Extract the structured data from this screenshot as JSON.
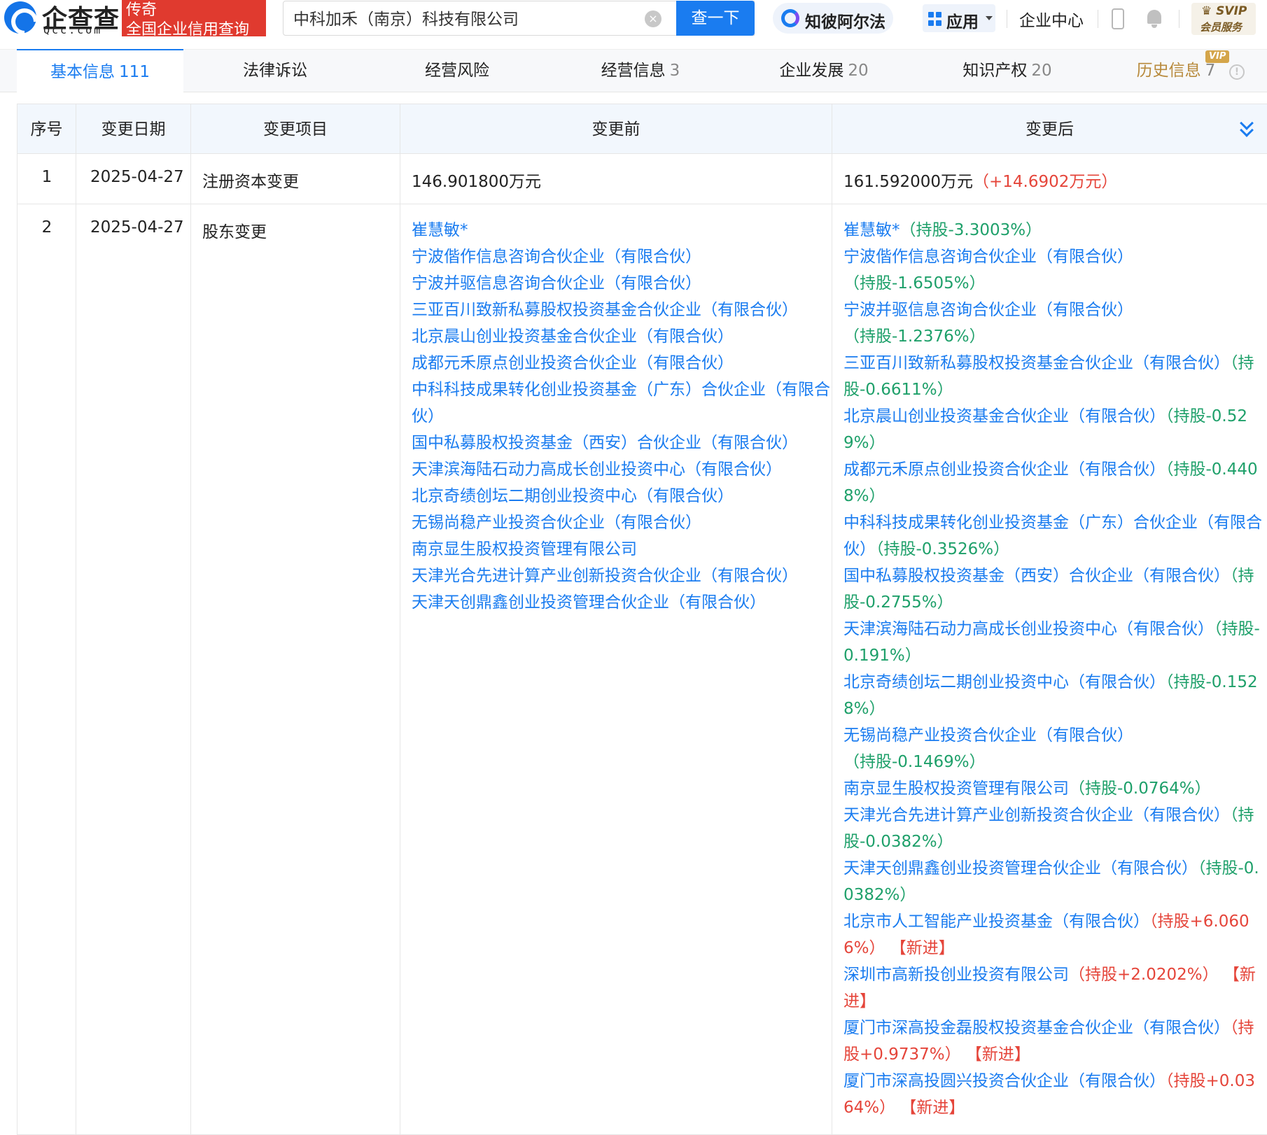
{
  "header": {
    "logo_cn": "企查查",
    "logo_en": "Qcc.com",
    "badge_line1": "传奇",
    "badge_line2": "全国企业信用查询",
    "search_value": "中科加禾（南京）科技有限公司",
    "search_button": "查一下",
    "ai_label": "知彼阿尔法",
    "apps_label": "应用",
    "enterprise_center": "企业中心",
    "svip_top": "SVIP",
    "svip_bottom": "会员服务"
  },
  "tabs": [
    {
      "label": "基本信息",
      "count": "111",
      "active": true
    },
    {
      "label": "法律诉讼",
      "count": ""
    },
    {
      "label": "经营风险",
      "count": ""
    },
    {
      "label": "经营信息",
      "count": "3"
    },
    {
      "label": "企业发展",
      "count": "20"
    },
    {
      "label": "知识产权",
      "count": "20"
    },
    {
      "label": "历史信息",
      "count": "7",
      "vip": "VIP"
    }
  ],
  "table": {
    "headers": [
      "序号",
      "变更日期",
      "变更项目",
      "变更前",
      "变更后"
    ],
    "rows": [
      {
        "seq": "1",
        "date": "2025-04-27",
        "item": "注册资本变更",
        "before": "146.901800万元",
        "after": "161.592000万元",
        "after_delta": "（+14.6902万元）"
      },
      {
        "seq": "2",
        "date": "2025-04-27",
        "item": "股东变更",
        "before_list": [
          "崔慧敏*",
          "宁波偕作信息咨询合伙企业（有限合伙）",
          "宁波并驱信息咨询合伙企业（有限合伙）",
          "三亚百川致新私募股权投资基金合伙企业（有限合伙）",
          "北京晨山创业投资基金合伙企业（有限合伙）",
          "成都元禾原点创业投资合伙企业（有限合伙）",
          "中科科技成果转化创业投资基金（广东）合伙企业（有限合伙）",
          "国中私募股权投资基金（西安）合伙企业（有限合伙）",
          "天津滨海陆石动力高成长创业投资中心（有限合伙）",
          "北京奇绩创坛二期创业投资中心（有限合伙）",
          "无锡尚稳产业投资合伙企业（有限合伙）",
          "南京显生股权投资管理有限公司",
          "天津光合先进计算产业创新投资合伙企业（有限合伙）",
          "天津天创鼎鑫创业投资管理合伙企业（有限合伙）"
        ],
        "after_list": [
          {
            "name": "崔慧敏*",
            "change": "（持股-3.3003%）",
            "tone": "green",
            "tag": ""
          },
          {
            "name": "宁波偕作信息咨询合伙企业（有限合伙）",
            "change": "（持股-1.6505%）",
            "tone": "green",
            "tag": ""
          },
          {
            "name": "宁波并驱信息咨询合伙企业（有限合伙）",
            "change": "（持股-1.2376%）",
            "tone": "green",
            "tag": ""
          },
          {
            "name": "三亚百川致新私募股权投资基金合伙企业（有限合伙）",
            "change": "（持股-0.6611%）",
            "tone": "green",
            "tag": ""
          },
          {
            "name": "北京晨山创业投资基金合伙企业（有限合伙）",
            "change": "（持股-0.529%）",
            "tone": "green",
            "tag": ""
          },
          {
            "name": "成都元禾原点创业投资合伙企业（有限合伙）",
            "change": "（持股-0.4408%）",
            "tone": "green",
            "tag": ""
          },
          {
            "name": "中科科技成果转化创业投资基金（广东）合伙企业（有限合伙）",
            "change": "（持股-0.3526%）",
            "tone": "green",
            "tag": ""
          },
          {
            "name": "国中私募股权投资基金（西安）合伙企业（有限合伙）",
            "change": "（持股-0.2755%）",
            "tone": "green",
            "tag": ""
          },
          {
            "name": "天津滨海陆石动力高成长创业投资中心（有限合伙）",
            "change": "（持股-0.191%）",
            "tone": "green",
            "tag": ""
          },
          {
            "name": "北京奇绩创坛二期创业投资中心（有限合伙）",
            "change": "（持股-0.1528%）",
            "tone": "green",
            "tag": ""
          },
          {
            "name": "无锡尚稳产业投资合伙企业（有限合伙）",
            "change": "（持股-0.1469%）",
            "tone": "green",
            "tag": ""
          },
          {
            "name": "南京显生股权投资管理有限公司",
            "change": "（持股-0.0764%）",
            "tone": "green",
            "tag": ""
          },
          {
            "name": "天津光合先进计算产业创新投资合伙企业（有限合伙）",
            "change": "（持股-0.0382%）",
            "tone": "green",
            "tag": ""
          },
          {
            "name": "天津天创鼎鑫创业投资管理合伙企业（有限合伙）",
            "change": "（持股-0.0382%）",
            "tone": "green",
            "tag": ""
          },
          {
            "name": "北京市人工智能产业投资基金（有限合伙）",
            "change": "（持股+6.0606%）",
            "tone": "red",
            "tag": "【新进】"
          },
          {
            "name": "深圳市高新投创业投资有限公司",
            "change": "（持股+2.0202%）",
            "tone": "red",
            "tag": "【新进】"
          },
          {
            "name": "厦门市深高投金磊股权投资基金合伙企业（有限合伙）",
            "change": "（持股+0.9737%）",
            "tone": "red",
            "tag": "【新进】"
          },
          {
            "name": "厦门市深高投圆兴投资合伙企业（有限合伙）",
            "change": "（持股+0.0364%）",
            "tone": "red",
            "tag": "【新进】"
          }
        ]
      }
    ]
  },
  "colors": {
    "accent": "#1a7cf0",
    "decrease": "#1ea06a",
    "increase": "#e5453a",
    "brand_red": "#e03a2f",
    "header_bg": "#f2f7fd"
  }
}
